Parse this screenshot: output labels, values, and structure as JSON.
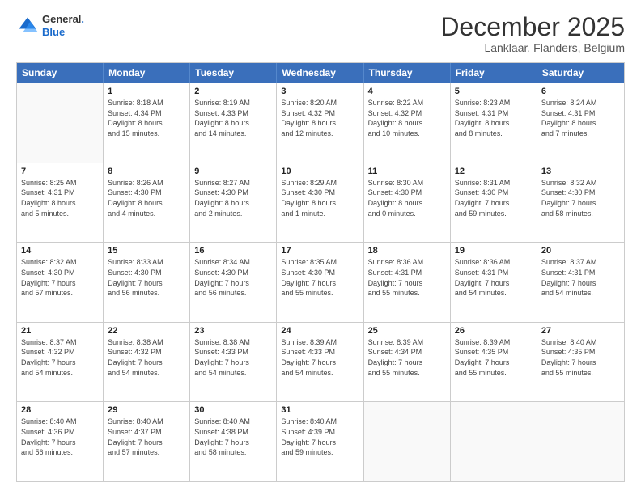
{
  "header": {
    "logo_line1": "General",
    "logo_line2": "Blue",
    "month_title": "December 2025",
    "subtitle": "Lanklaar, Flanders, Belgium"
  },
  "weekdays": [
    "Sunday",
    "Monday",
    "Tuesday",
    "Wednesday",
    "Thursday",
    "Friday",
    "Saturday"
  ],
  "rows": [
    [
      {
        "day": "",
        "info": ""
      },
      {
        "day": "1",
        "info": "Sunrise: 8:18 AM\nSunset: 4:34 PM\nDaylight: 8 hours\nand 15 minutes."
      },
      {
        "day": "2",
        "info": "Sunrise: 8:19 AM\nSunset: 4:33 PM\nDaylight: 8 hours\nand 14 minutes."
      },
      {
        "day": "3",
        "info": "Sunrise: 8:20 AM\nSunset: 4:32 PM\nDaylight: 8 hours\nand 12 minutes."
      },
      {
        "day": "4",
        "info": "Sunrise: 8:22 AM\nSunset: 4:32 PM\nDaylight: 8 hours\nand 10 minutes."
      },
      {
        "day": "5",
        "info": "Sunrise: 8:23 AM\nSunset: 4:31 PM\nDaylight: 8 hours\nand 8 minutes."
      },
      {
        "day": "6",
        "info": "Sunrise: 8:24 AM\nSunset: 4:31 PM\nDaylight: 8 hours\nand 7 minutes."
      }
    ],
    [
      {
        "day": "7",
        "info": "Sunrise: 8:25 AM\nSunset: 4:31 PM\nDaylight: 8 hours\nand 5 minutes."
      },
      {
        "day": "8",
        "info": "Sunrise: 8:26 AM\nSunset: 4:30 PM\nDaylight: 8 hours\nand 4 minutes."
      },
      {
        "day": "9",
        "info": "Sunrise: 8:27 AM\nSunset: 4:30 PM\nDaylight: 8 hours\nand 2 minutes."
      },
      {
        "day": "10",
        "info": "Sunrise: 8:29 AM\nSunset: 4:30 PM\nDaylight: 8 hours\nand 1 minute."
      },
      {
        "day": "11",
        "info": "Sunrise: 8:30 AM\nSunset: 4:30 PM\nDaylight: 8 hours\nand 0 minutes."
      },
      {
        "day": "12",
        "info": "Sunrise: 8:31 AM\nSunset: 4:30 PM\nDaylight: 7 hours\nand 59 minutes."
      },
      {
        "day": "13",
        "info": "Sunrise: 8:32 AM\nSunset: 4:30 PM\nDaylight: 7 hours\nand 58 minutes."
      }
    ],
    [
      {
        "day": "14",
        "info": "Sunrise: 8:32 AM\nSunset: 4:30 PM\nDaylight: 7 hours\nand 57 minutes."
      },
      {
        "day": "15",
        "info": "Sunrise: 8:33 AM\nSunset: 4:30 PM\nDaylight: 7 hours\nand 56 minutes."
      },
      {
        "day": "16",
        "info": "Sunrise: 8:34 AM\nSunset: 4:30 PM\nDaylight: 7 hours\nand 56 minutes."
      },
      {
        "day": "17",
        "info": "Sunrise: 8:35 AM\nSunset: 4:30 PM\nDaylight: 7 hours\nand 55 minutes."
      },
      {
        "day": "18",
        "info": "Sunrise: 8:36 AM\nSunset: 4:31 PM\nDaylight: 7 hours\nand 55 minutes."
      },
      {
        "day": "19",
        "info": "Sunrise: 8:36 AM\nSunset: 4:31 PM\nDaylight: 7 hours\nand 54 minutes."
      },
      {
        "day": "20",
        "info": "Sunrise: 8:37 AM\nSunset: 4:31 PM\nDaylight: 7 hours\nand 54 minutes."
      }
    ],
    [
      {
        "day": "21",
        "info": "Sunrise: 8:37 AM\nSunset: 4:32 PM\nDaylight: 7 hours\nand 54 minutes."
      },
      {
        "day": "22",
        "info": "Sunrise: 8:38 AM\nSunset: 4:32 PM\nDaylight: 7 hours\nand 54 minutes."
      },
      {
        "day": "23",
        "info": "Sunrise: 8:38 AM\nSunset: 4:33 PM\nDaylight: 7 hours\nand 54 minutes."
      },
      {
        "day": "24",
        "info": "Sunrise: 8:39 AM\nSunset: 4:33 PM\nDaylight: 7 hours\nand 54 minutes."
      },
      {
        "day": "25",
        "info": "Sunrise: 8:39 AM\nSunset: 4:34 PM\nDaylight: 7 hours\nand 55 minutes."
      },
      {
        "day": "26",
        "info": "Sunrise: 8:39 AM\nSunset: 4:35 PM\nDaylight: 7 hours\nand 55 minutes."
      },
      {
        "day": "27",
        "info": "Sunrise: 8:40 AM\nSunset: 4:35 PM\nDaylight: 7 hours\nand 55 minutes."
      }
    ],
    [
      {
        "day": "28",
        "info": "Sunrise: 8:40 AM\nSunset: 4:36 PM\nDaylight: 7 hours\nand 56 minutes."
      },
      {
        "day": "29",
        "info": "Sunrise: 8:40 AM\nSunset: 4:37 PM\nDaylight: 7 hours\nand 57 minutes."
      },
      {
        "day": "30",
        "info": "Sunrise: 8:40 AM\nSunset: 4:38 PM\nDaylight: 7 hours\nand 58 minutes."
      },
      {
        "day": "31",
        "info": "Sunrise: 8:40 AM\nSunset: 4:39 PM\nDaylight: 7 hours\nand 59 minutes."
      },
      {
        "day": "",
        "info": ""
      },
      {
        "day": "",
        "info": ""
      },
      {
        "day": "",
        "info": ""
      }
    ]
  ]
}
